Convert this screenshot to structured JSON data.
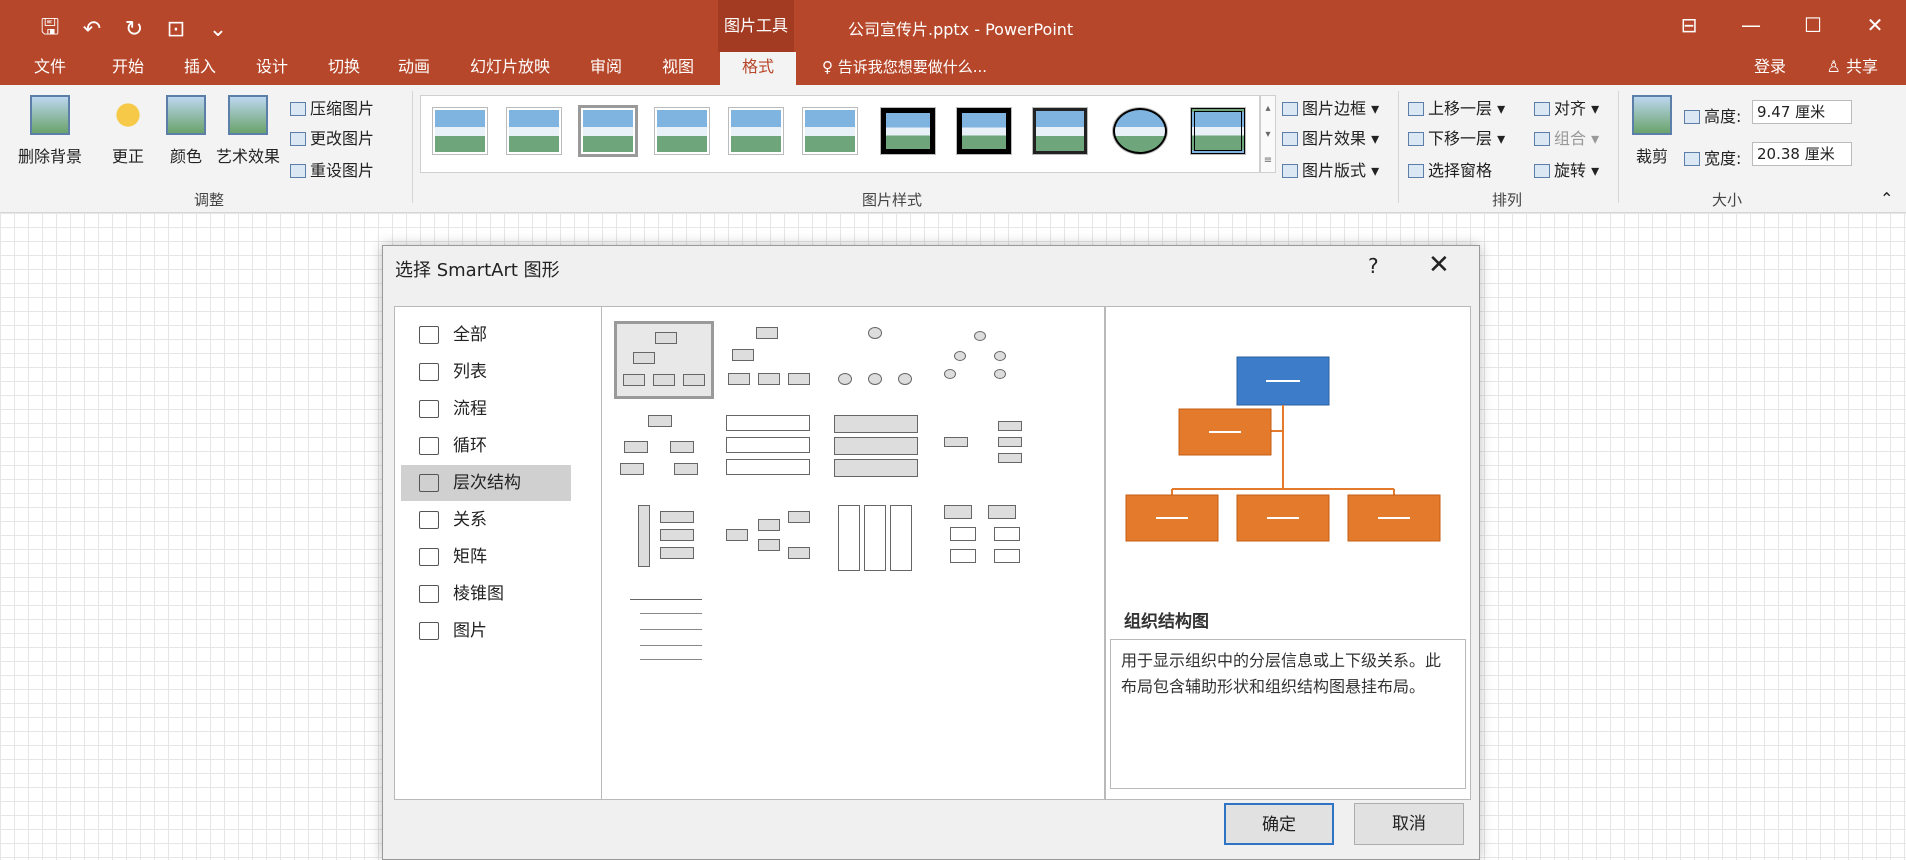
{
  "window": {
    "doc_title": "公司宣传片.pptx - PowerPoint",
    "context_tab": "图片工具"
  },
  "tabs": [
    "文件",
    "开始",
    "插入",
    "设计",
    "切换",
    "动画",
    "幻灯片放映",
    "审阅",
    "视图",
    "格式"
  ],
  "tell_me": "告诉我您想要做什么...",
  "login": "登录",
  "share": "共享",
  "ribbon": {
    "remove_bg": "删除背景",
    "correct": "更正",
    "color": "颜色",
    "artistic": "艺术效果",
    "compress": "压缩图片",
    "change": "更改图片",
    "reset": "重设图片",
    "adjust_label": "调整",
    "styles_label": "图片样式",
    "border": "图片边框",
    "effects": "图片效果",
    "layout": "图片版式",
    "bring_forward": "上移一层",
    "send_backward": "下移一层",
    "selection_pane": "选择窗格",
    "align": "对齐",
    "group": "组合",
    "rotate": "旋转",
    "arrange_label": "排列",
    "crop": "裁剪",
    "height_label": "高度:",
    "height_value": "9.47 厘米",
    "width_label": "宽度:",
    "width_value": "20.38 厘米",
    "size_label": "大小"
  },
  "dialog": {
    "title": "选择 SmartArt 图形",
    "help": "?",
    "close": "✕",
    "categories": [
      "全部",
      "列表",
      "流程",
      "循环",
      "层次结构",
      "关系",
      "矩阵",
      "棱锥图",
      "图片"
    ],
    "selected_category": "层次结构",
    "preview_title": "组织结构图",
    "preview_desc": "用于显示组织中的分层信息或上下级关系。此布局包含辅助形状和组织结构图悬挂布局。",
    "ok": "确定",
    "cancel": "取消"
  }
}
